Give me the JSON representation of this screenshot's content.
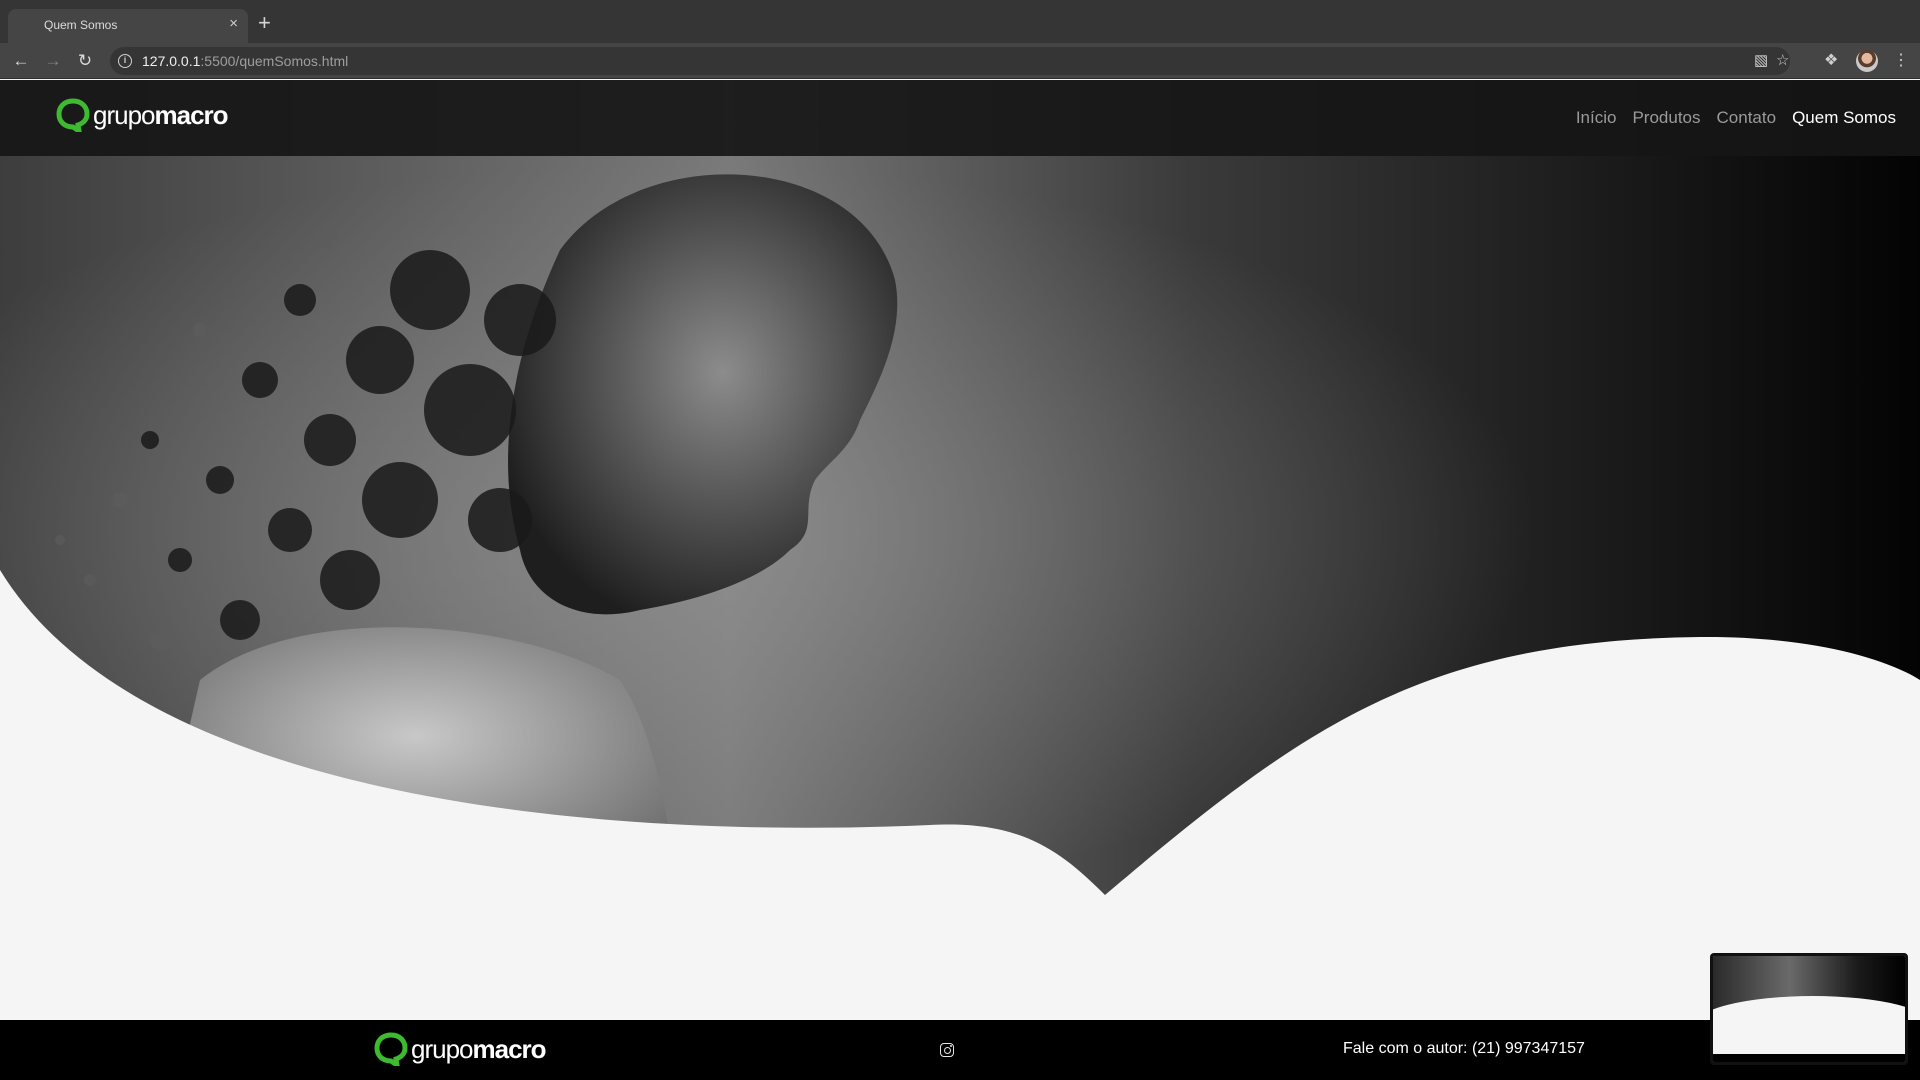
{
  "browser": {
    "tab_title": "Quem Somos",
    "tab_close_glyph": "×",
    "new_tab_glyph": "+",
    "url_host": "127.0.0.1",
    "url_rest": ":5500/quemSomos.html",
    "icons": [
      "back-icon",
      "forward-icon",
      "reload-icon",
      "info-icon",
      "translate-icon",
      "star-icon",
      "extensions-icon",
      "profile-avatar",
      "menu-icon"
    ]
  },
  "site": {
    "brand_light": "grupo",
    "brand_bold": "macro",
    "brand_color": "#3dba2f",
    "nav": [
      {
        "label": "Início"
      },
      {
        "label": "Produtos"
      },
      {
        "label": "Contato"
      },
      {
        "label": "Quem Somos",
        "active": true
      }
    ]
  },
  "footer": {
    "brand_light": "grupo",
    "brand_bold": "macro",
    "social_icon": "instagram-icon",
    "contact": "Fale com o autor: (21) 997347157"
  }
}
